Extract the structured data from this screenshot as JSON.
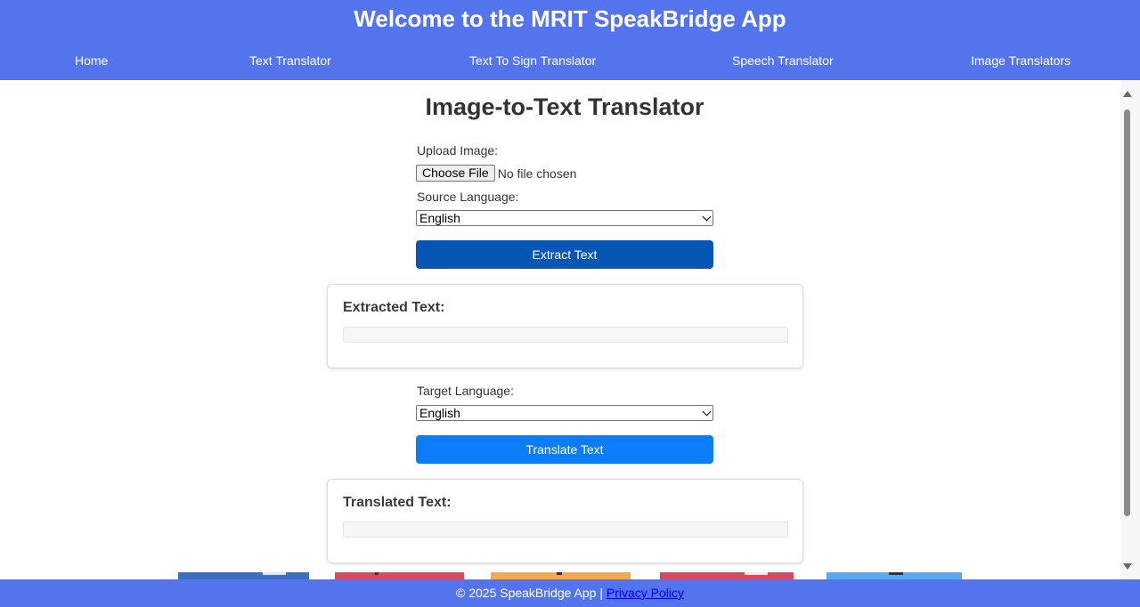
{
  "header": {
    "title": "Welcome to the MRIT SpeakBridge App",
    "background": "#5474ee"
  },
  "nav": {
    "items": [
      {
        "label": "Home"
      },
      {
        "label": "Text Translator"
      },
      {
        "label": "Text To Sign Translator"
      },
      {
        "label": "Speech Translator"
      },
      {
        "label": "Image Translators"
      }
    ]
  },
  "main": {
    "title": "Image-to-Text Translator",
    "upload": {
      "label": "Upload Image:",
      "button_label": "Choose File",
      "status": "No file chosen"
    },
    "source_language": {
      "label": "Source Language:",
      "selected": "English"
    },
    "extract_button": {
      "label": "Extract Text",
      "color": "#0856b3"
    },
    "extracted": {
      "title": "Extracted Text:",
      "value": ""
    },
    "target_language": {
      "label": "Target Language:",
      "selected": "English"
    },
    "translate_button": {
      "label": "Translate Text",
      "color": "#0d7cf7"
    },
    "translated": {
      "title": "Translated Text:",
      "value": ""
    }
  },
  "footer": {
    "copyright": "© 2025 SpeakBridge App |",
    "privacy_link": "Privacy Policy"
  },
  "colors": {
    "accent": "#5474ee",
    "link": "#0000ee"
  }
}
